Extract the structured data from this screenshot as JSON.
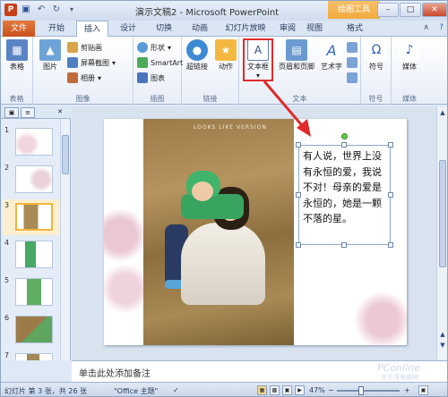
{
  "window": {
    "title": "演示文稿2 - Microsoft PowerPoint",
    "context_tab_title": "绘图工具"
  },
  "qat": {
    "app_icon_letter": "P"
  },
  "tabs": [
    {
      "label": "文件"
    },
    {
      "label": "开始"
    },
    {
      "label": "插入"
    },
    {
      "label": "设计"
    },
    {
      "label": "切换"
    },
    {
      "label": "动画"
    },
    {
      "label": "幻灯片放映"
    },
    {
      "label": "审阅"
    },
    {
      "label": "视图"
    },
    {
      "label": "格式"
    }
  ],
  "ribbon": {
    "groups": {
      "tables": {
        "label": "表格",
        "btn": "表格"
      },
      "images": {
        "label": "图像",
        "picture": "图片",
        "clipart": "剪贴画",
        "screenshot": "屏幕截图",
        "album": "相册"
      },
      "illustrations": {
        "label": "插图",
        "shapes": "形状",
        "smartart": "SmartArt",
        "chart": "图表"
      },
      "links": {
        "label": "链接",
        "hyperlink": "超链接",
        "action": "动作"
      },
      "text": {
        "label": "文本",
        "textbox": "文本框",
        "header_footer": "页眉和页脚",
        "wordart": "艺术字"
      },
      "symbols": {
        "label": "符号",
        "btn": "符号"
      },
      "media": {
        "label": "媒体",
        "btn": "媒体"
      }
    }
  },
  "slides": [
    {
      "num": "1"
    },
    {
      "num": "2"
    },
    {
      "num": "3"
    },
    {
      "num": "4"
    },
    {
      "num": "5"
    },
    {
      "num": "6"
    },
    {
      "num": "7"
    }
  ],
  "slide": {
    "photo_caption": "LOOKS LIKE VERSION",
    "textbox_text": "有人说，世界上没有永恒的爱，我说不对！母亲的爱是永恒的，她是一颗不落的星。"
  },
  "notes": {
    "placeholder": "单击此处添加备注"
  },
  "status": {
    "slide_info": "幻灯片 第 3 张，共 26 张",
    "theme": "\"Office 主题\"",
    "zoom": "47%"
  },
  "watermark": {
    "main": "PConline",
    "sub": "太平洋电脑网"
  },
  "colors": {
    "highlight": "#e02a2a",
    "file_tab": "#c8501c",
    "context": "#f1a93c"
  }
}
